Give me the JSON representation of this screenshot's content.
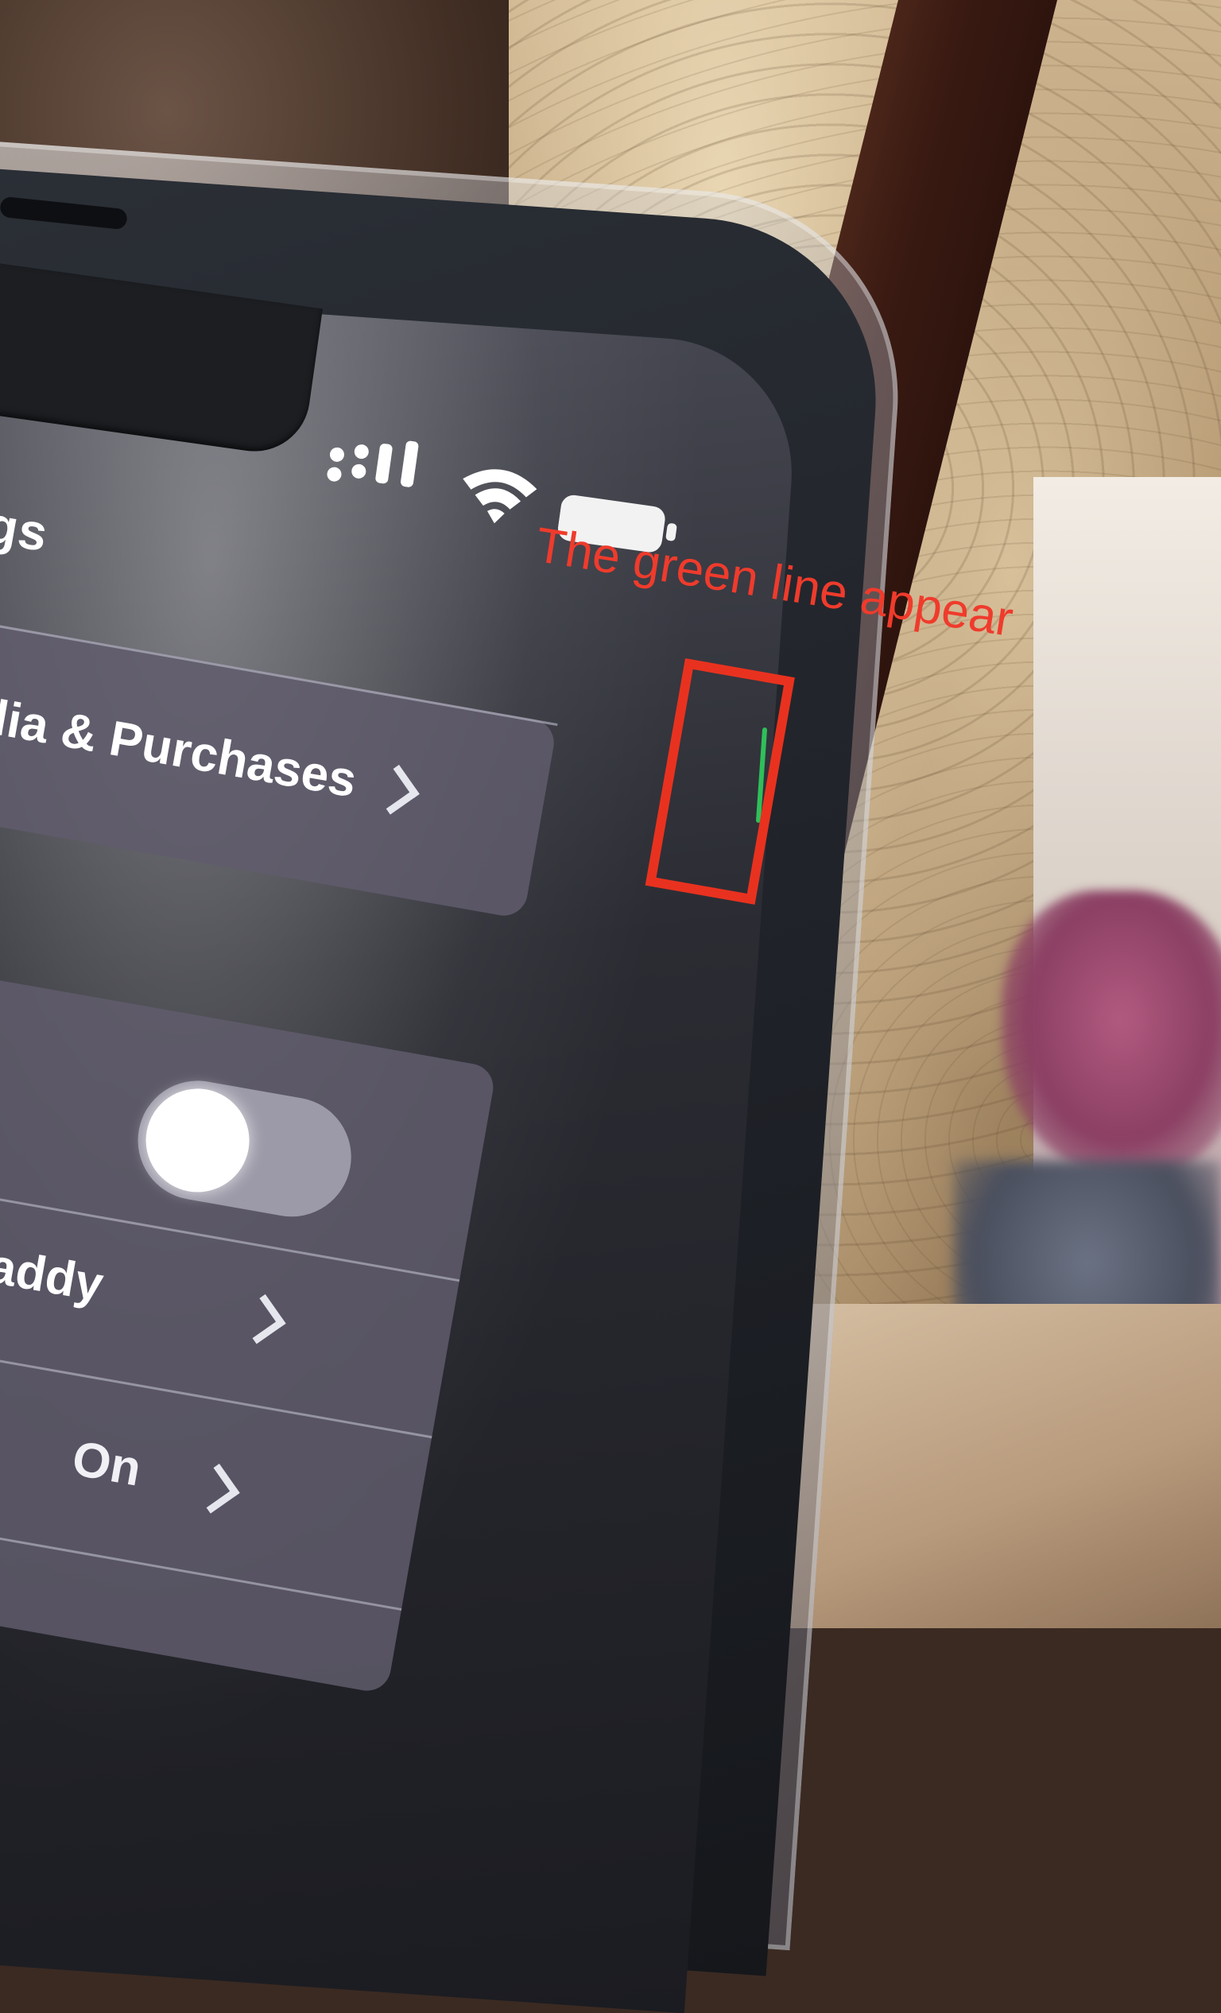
{
  "settings_screen": {
    "title_fragment": "gs",
    "rows": [
      {
        "label": "dia & Purchases"
      },
      {
        "label": "/ Hi to Daddy"
      },
      {
        "value": "On"
      }
    ],
    "toggle_state": "on"
  },
  "annotation": {
    "text": "The green line appear",
    "color": "#ef3b2c"
  },
  "status_bar": {
    "icons": [
      "signal-icon",
      "wifi-icon",
      "battery-icon"
    ]
  }
}
